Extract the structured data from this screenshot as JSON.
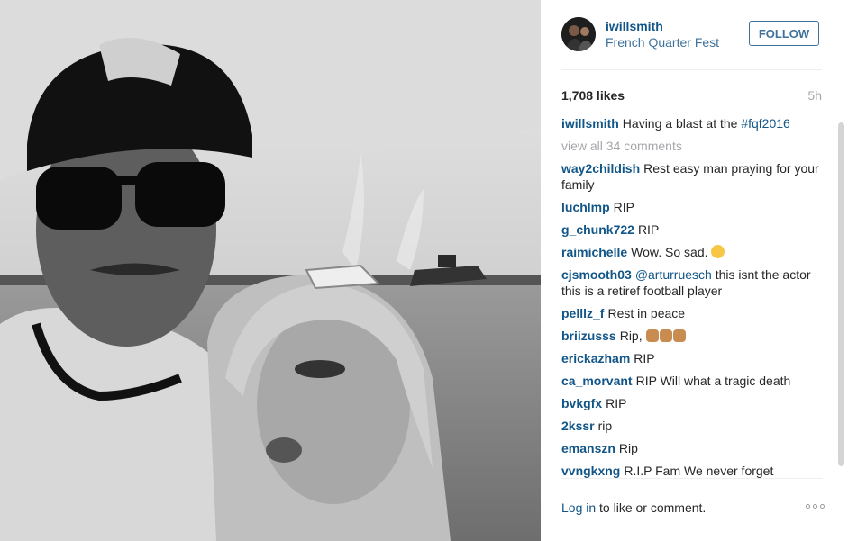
{
  "post": {
    "username": "iwillsmith",
    "location": "French Quarter Fest",
    "follow_label": "FOLLOW",
    "likes": "1,708 likes",
    "time": "5h"
  },
  "caption": {
    "user": "iwillsmith",
    "text": "Having a blast at the ",
    "hashtag": "#fqf2016"
  },
  "view_all": "view all 34 comments",
  "comments": [
    {
      "user": "way2childish",
      "text": "Rest easy man praying for your family"
    },
    {
      "user": "luchlmp",
      "text": "RIP"
    },
    {
      "user": "g_chunk722",
      "text": "RIP"
    },
    {
      "user": "raimichelle",
      "text": "Wow. So sad."
    },
    {
      "user": "cjsmooth03",
      "mention": "@arturruesch",
      "text": " this isnt the actor this is a retiref football player"
    },
    {
      "user": "pelllz_f",
      "text": "Rest in peace"
    },
    {
      "user": "briizusss",
      "text": "Rip,"
    },
    {
      "user": "erickazham",
      "text": "RIP"
    },
    {
      "user": "ca_morvant",
      "text": "RIP Will what a tragic death"
    },
    {
      "user": "bvkgfx",
      "text": "RIP"
    },
    {
      "user": "2kssr",
      "text": "rip"
    },
    {
      "user": "emanszn",
      "text": "Rip"
    },
    {
      "user": "vvngkxng",
      "text": "R.I.P Fam We never forget"
    }
  ],
  "footer": {
    "login_link": "Log in",
    "login_text": " to like or comment."
  },
  "icons": {
    "more": "ellipsis-icon"
  }
}
